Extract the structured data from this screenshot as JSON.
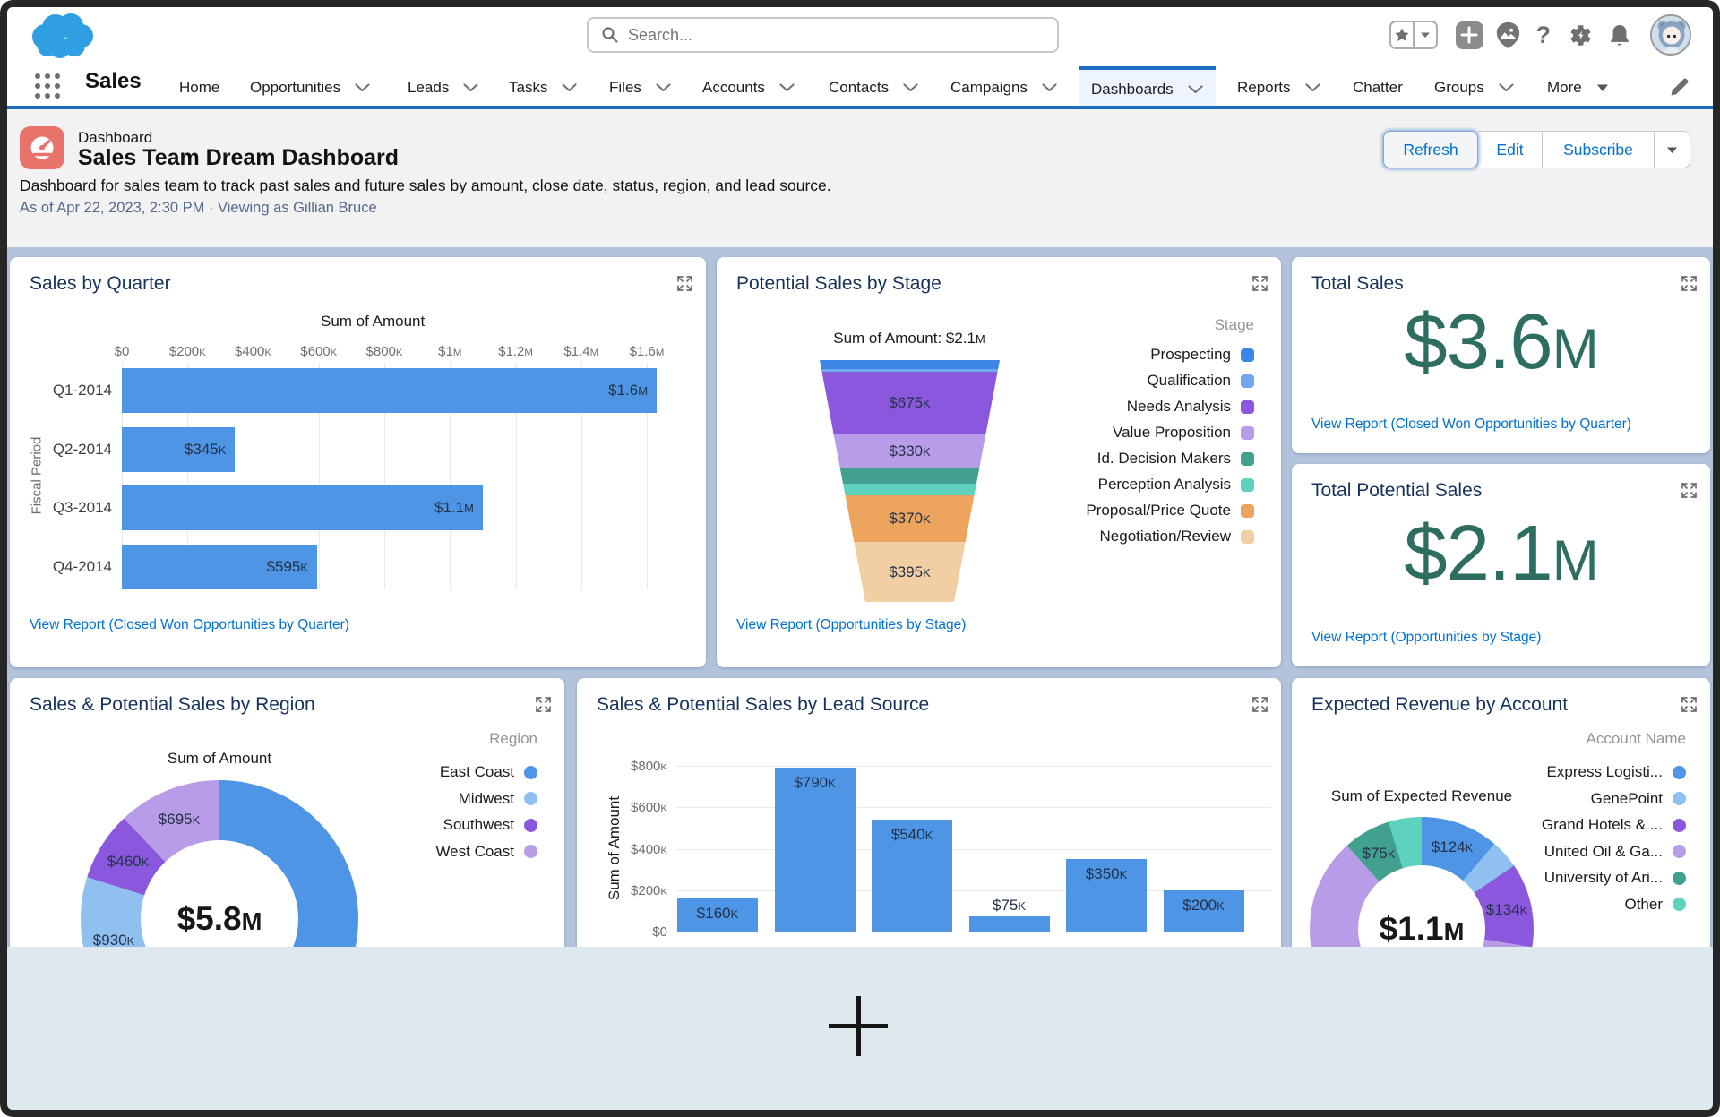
{
  "header": {
    "search_placeholder": "Search...",
    "icons": [
      "favorites-star",
      "favorites-dropdown",
      "global-actions-plus",
      "trailhead",
      "help",
      "setup-gear",
      "notifications-bell",
      "avatar"
    ]
  },
  "nav": {
    "app_name": "Sales",
    "tabs": [
      {
        "label": "Home",
        "chevron": false,
        "active": false
      },
      {
        "label": "Opportunities",
        "chevron": true,
        "active": false
      },
      {
        "label": "Leads",
        "chevron": true,
        "active": false
      },
      {
        "label": "Tasks",
        "chevron": true,
        "active": false
      },
      {
        "label": "Files",
        "chevron": true,
        "active": false
      },
      {
        "label": "Accounts",
        "chevron": true,
        "active": false
      },
      {
        "label": "Contacts",
        "chevron": true,
        "active": false
      },
      {
        "label": "Campaigns",
        "chevron": true,
        "active": false
      },
      {
        "label": "Dashboards",
        "chevron": true,
        "active": true
      },
      {
        "label": "Reports",
        "chevron": true,
        "active": false
      },
      {
        "label": "Chatter",
        "chevron": false,
        "active": false
      },
      {
        "label": "Groups",
        "chevron": true,
        "active": false
      },
      {
        "label": "More",
        "chevron": "solid",
        "active": false
      }
    ]
  },
  "page_header": {
    "record_type": "Dashboard",
    "title": "Sales Team Dream Dashboard",
    "description": "Dashboard for sales team to track past sales and future sales by amount, close date, status, region, and lead source.",
    "as_of": "As of Apr 22, 2023, 2:30 PM · Viewing as Gillian Bruce",
    "buttons": {
      "refresh": "Refresh",
      "edit": "Edit",
      "subscribe": "Subscribe"
    }
  },
  "colors": {
    "brand_blue": "#1b6fc2",
    "link_blue": "#0070d2",
    "bar_blue": "#4e95e5",
    "metric_green": "#2e6e60",
    "series": {
      "blue": "#4e95e5",
      "light_blue": "#8fc0f0",
      "purple": "#8a57dd",
      "light_purple": "#b99ce8",
      "teal": "#41a18e",
      "light_teal": "#5ed2bf",
      "orange": "#eda55e",
      "tan": "#f1cfa2",
      "funnel_blue": "#3c86e8",
      "funnel_light_blue": "#6fa9ee"
    }
  },
  "cards": {
    "sales_by_quarter": {
      "title": "Sales by Quarter",
      "view_report": "View Report (Closed Won Opportunities by Quarter)",
      "chart_data": {
        "type": "bar",
        "orientation": "horizontal",
        "title": "Sum of Amount",
        "ylabel": "Fiscal Period",
        "categories": [
          "Q1-2014",
          "Q2-2014",
          "Q3-2014",
          "Q4-2014"
        ],
        "values": [
          1630000,
          345000,
          1100000,
          595000
        ],
        "labels": [
          "$1.6M",
          "$345K",
          "$1.1M",
          "$595K"
        ],
        "ticks": [
          "$0",
          "$200K",
          "$400K",
          "$600K",
          "$800K",
          "$1M",
          "$1.2M",
          "$1.4M",
          "$1.6M"
        ],
        "tick_step": 200000,
        "grid": true
      }
    },
    "potential_sales_by_stage": {
      "title": "Potential Sales by Stage",
      "view_report": "View Report (Opportunities by Stage)",
      "chart_data": {
        "type": "funnel",
        "title": "Sum of Amount: $2.1M",
        "legend_title": "Stage",
        "series": [
          {
            "name": "Prospecting",
            "value": 105000,
            "label": null,
            "color": "#3c86e8"
          },
          {
            "name": "Qualification",
            "value": 30000,
            "label": null,
            "color": "#6fa9ee"
          },
          {
            "name": "Needs Analysis",
            "value": 675000,
            "label": "$675K",
            "color": "#8a57dd"
          },
          {
            "name": "Value Proposition",
            "value": 330000,
            "label": "$330K",
            "color": "#b99ce8"
          },
          {
            "name": "Id. Decision Makers",
            "value": 129000,
            "label": null,
            "color": "#41a18e"
          },
          {
            "name": "Perception Analysis",
            "value": 101000,
            "label": null,
            "color": "#5ed2bf"
          },
          {
            "name": "Proposal/Price Quote",
            "value": 370000,
            "label": "$370K",
            "color": "#eda55e"
          },
          {
            "name": "Negotiation/Review",
            "value": 395000,
            "label": "$395K",
            "color": "#f1cfa2"
          }
        ]
      }
    },
    "total_sales": {
      "title": "Total Sales",
      "value": "$3.6M",
      "view_report": "View Report (Closed Won Opportunities by Quarter)"
    },
    "total_potential_sales": {
      "title": "Total Potential Sales",
      "value": "$2.1M",
      "view_report": "View Report (Opportunities by Stage)"
    },
    "sales_by_region": {
      "title": "Sales & Potential Sales by Region",
      "chart_data": {
        "type": "donut",
        "title": "Sum of Amount",
        "center": "$5.8M",
        "legend_title": "Region",
        "series": [
          {
            "name": "East Coast",
            "value": 3660000,
            "label": null,
            "color": "#4e95e5"
          },
          {
            "name": "Midwest",
            "value": 930000,
            "label": "$930K",
            "color": "#8fc0f0"
          },
          {
            "name": "Southwest",
            "value": 460000,
            "label": "$460K",
            "color": "#8a57dd"
          },
          {
            "name": "West Coast",
            "value": 695000,
            "label": "$695K",
            "color": "#b99ce8"
          }
        ]
      }
    },
    "sales_by_lead_source": {
      "title": "Sales & Potential Sales by Lead Source",
      "chart_data": {
        "type": "bar",
        "orientation": "vertical",
        "ylabel": "Sum of Amount",
        "values": [
          160000,
          790000,
          540000,
          75000,
          350000,
          200000
        ],
        "labels": [
          "$160K",
          "$790K",
          "$540K",
          "$75K",
          "$350K",
          "$200K"
        ],
        "ticks": [
          "$0",
          "$200K",
          "$400K",
          "$600K",
          "$800K"
        ],
        "tick_step": 200000,
        "grid": true
      }
    },
    "expected_revenue_by_account": {
      "title": "Expected Revenue by Account",
      "chart_data": {
        "type": "donut",
        "title": "Sum of Expected Revenue",
        "center": "$1.1M",
        "legend_title": "Account Name",
        "series": [
          {
            "name": "Express Logisti...",
            "value": 124000,
            "label": "$124K",
            "color": "#4e95e5"
          },
          {
            "name": "GenePoint",
            "value": 46000,
            "label": null,
            "color": "#8fc0f0"
          },
          {
            "name": "Grand Hotels & ...",
            "value": 134000,
            "label": "$134K",
            "color": "#8a57dd"
          },
          {
            "name": "United Oil & Ga...",
            "value": 669000,
            "label": null,
            "color": "#b99ce8"
          },
          {
            "name": "University of Ari...",
            "value": 75000,
            "label": "$75K",
            "color": "#41a18e"
          },
          {
            "name": "Other",
            "value": 53000,
            "label": null,
            "color": "#5ed2bf"
          }
        ]
      }
    }
  }
}
